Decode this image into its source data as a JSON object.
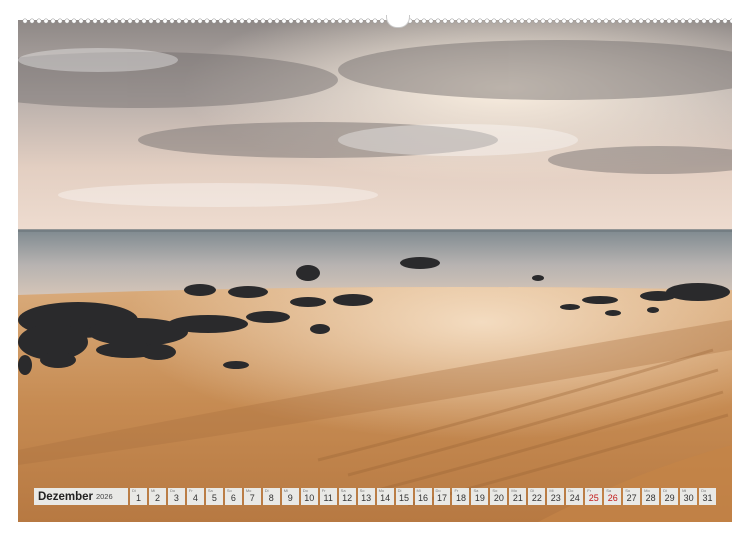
{
  "calendar": {
    "month": "Dezember",
    "year": "2026",
    "holiday_color": "#c21818",
    "days": [
      {
        "num": "1",
        "abbr": "Di",
        "holiday": false
      },
      {
        "num": "2",
        "abbr": "Mi",
        "holiday": false
      },
      {
        "num": "3",
        "abbr": "Do",
        "holiday": false
      },
      {
        "num": "4",
        "abbr": "Fr",
        "holiday": false
      },
      {
        "num": "5",
        "abbr": "Sa",
        "holiday": false
      },
      {
        "num": "6",
        "abbr": "So",
        "holiday": false
      },
      {
        "num": "7",
        "abbr": "Mo",
        "holiday": false
      },
      {
        "num": "8",
        "abbr": "Di",
        "holiday": false
      },
      {
        "num": "9",
        "abbr": "Mi",
        "holiday": false
      },
      {
        "num": "10",
        "abbr": "Do",
        "holiday": false
      },
      {
        "num": "11",
        "abbr": "Fr",
        "holiday": false
      },
      {
        "num": "12",
        "abbr": "Sa",
        "holiday": false
      },
      {
        "num": "13",
        "abbr": "So",
        "holiday": false
      },
      {
        "num": "14",
        "abbr": "Mo",
        "holiday": false
      },
      {
        "num": "15",
        "abbr": "Di",
        "holiday": false
      },
      {
        "num": "16",
        "abbr": "Mi",
        "holiday": false
      },
      {
        "num": "17",
        "abbr": "Do",
        "holiday": false
      },
      {
        "num": "18",
        "abbr": "Fr",
        "holiday": false
      },
      {
        "num": "19",
        "abbr": "Sa",
        "holiday": false
      },
      {
        "num": "20",
        "abbr": "So",
        "holiday": false
      },
      {
        "num": "21",
        "abbr": "Mo",
        "holiday": false
      },
      {
        "num": "22",
        "abbr": "Di",
        "holiday": false
      },
      {
        "num": "23",
        "abbr": "Mi",
        "holiday": false
      },
      {
        "num": "24",
        "abbr": "Do",
        "holiday": false
      },
      {
        "num": "25",
        "abbr": "Fr",
        "holiday": true
      },
      {
        "num": "26",
        "abbr": "Sa",
        "holiday": true
      },
      {
        "num": "27",
        "abbr": "So",
        "holiday": false
      },
      {
        "num": "28",
        "abbr": "Mo",
        "holiday": false
      },
      {
        "num": "29",
        "abbr": "Di",
        "holiday": false
      },
      {
        "num": "30",
        "abbr": "Mi",
        "holiday": false
      },
      {
        "num": "31",
        "abbr": "Do",
        "holiday": false
      }
    ]
  },
  "photo": {
    "icon": "beach-seascape-photo",
    "sky_color": "#c9bcb4",
    "sand_color": "#c58a50"
  }
}
